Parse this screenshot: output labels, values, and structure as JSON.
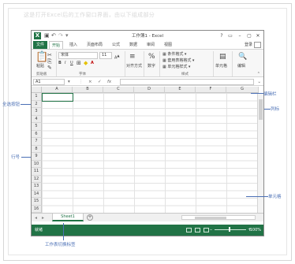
{
  "blurred_caption": "这是打开Excel后的工作窗口界面，由以下组成部分",
  "window": {
    "title": "工作簿1 - Excel",
    "window_controls": [
      "?",
      "▭",
      "–",
      "▢",
      "✕"
    ],
    "login": "登录"
  },
  "tabs": [
    "文件",
    "开始",
    "插入",
    "页面布局",
    "公式",
    "数据",
    "审阅",
    "视图"
  ],
  "ribbon": {
    "paste_label": "粘贴",
    "font_name": "宋体",
    "font_size": "11",
    "format_buttons": [
      "B",
      "I",
      "U",
      "A",
      "A"
    ],
    "number_label": "数字",
    "align_label": "对齐方式",
    "cond_format": "条件格式",
    "table_format": "套用表格格式",
    "cell_style": "单元格样式",
    "cells_label": "单元格",
    "edit_label": "编辑",
    "groups": [
      "剪贴板",
      "字体",
      "样式"
    ]
  },
  "formula_bar": {
    "name_box": "A1",
    "cancel": "×",
    "enter": "✓",
    "fx": "fx"
  },
  "columns": [
    "A",
    "B",
    "C",
    "D",
    "E",
    "F",
    "G"
  ],
  "rows": [
    "1",
    "2",
    "3",
    "4",
    "5",
    "6",
    "7",
    "8",
    "9",
    "10",
    "11",
    "12",
    "13",
    "14",
    "15",
    "16"
  ],
  "sheet": {
    "tab": "Sheet1",
    "add": "+"
  },
  "status": {
    "ready": "就绪",
    "zoom_minus": "–",
    "zoom_plus": "+",
    "zoom": "100%"
  },
  "callouts": {
    "select_all": "全选按钮",
    "row_number": "行号",
    "sheet_tabs": "工作表切换标签",
    "edit_bar": "编辑栏",
    "column": "列标",
    "cell": "单元格"
  }
}
